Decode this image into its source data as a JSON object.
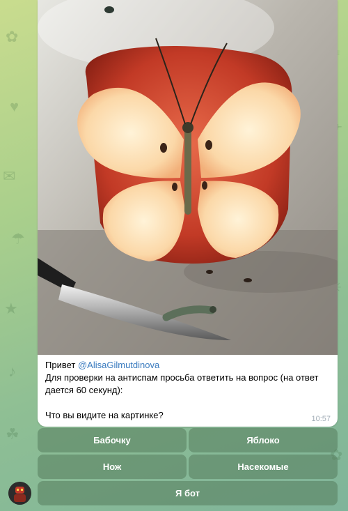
{
  "message": {
    "greeting": "Привет",
    "mention": "@AlisaGilmutdinova",
    "line_main": "Для проверки на антиспам просьба ответить на вопрос (на ответ дается 60 секунд):",
    "question": "Что вы видите на картинке?",
    "time": "10:57",
    "image_icon": "apple-butterfly-painting"
  },
  "keyboard": {
    "row1": [
      "Бабочку",
      "Яблоко"
    ],
    "row2": [
      "Нож",
      "Насекомые"
    ],
    "row3": [
      "Я бот"
    ]
  },
  "avatar_icon": "bot-avatar",
  "colors": {
    "mention": "#3a7bbf",
    "button_bg": "#567c5c",
    "bubble": "#ffffff"
  }
}
